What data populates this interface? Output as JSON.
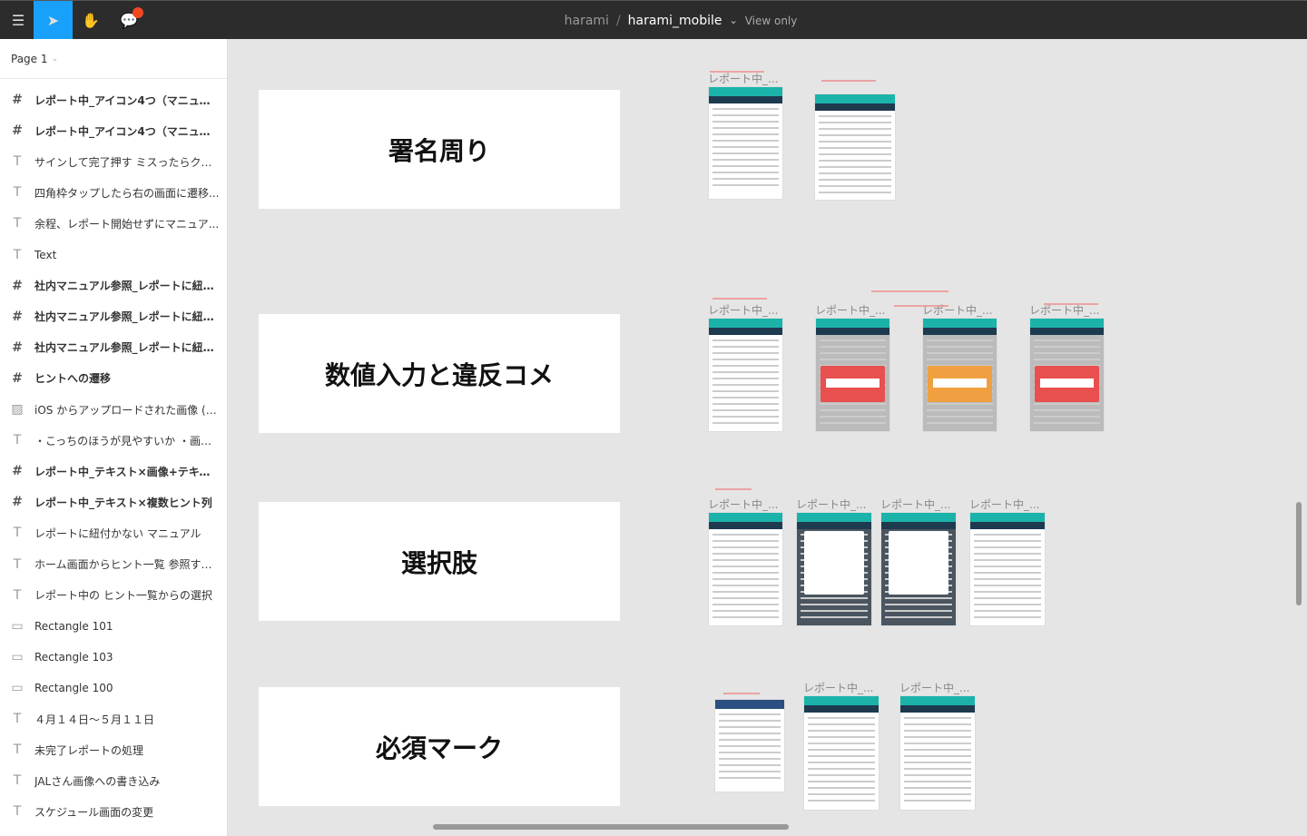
{
  "topbar": {
    "project": "harami",
    "separator": "/",
    "file": "harami_mobile",
    "chevron": "⌄",
    "mode": "View only"
  },
  "sidebar": {
    "page": "Page 1",
    "layers": [
      {
        "type": "frame",
        "label": "レポート中_アイコン4つ（マニュア..."
      },
      {
        "type": "frame",
        "label": "レポート中_アイコン4つ（マニュア..."
      },
      {
        "type": "text",
        "label": "サインして完了押す ミスったらクリ..."
      },
      {
        "type": "text",
        "label": "四角枠タップしたら右の画面に遷移..."
      },
      {
        "type": "text",
        "label": "余程、レポート開始せずにマニュア..."
      },
      {
        "type": "text",
        "label": "Text"
      },
      {
        "type": "frame",
        "label": "社内マニュアル参照_レポートに紐付..."
      },
      {
        "type": "frame",
        "label": "社内マニュアル参照_レポートに紐付..."
      },
      {
        "type": "frame",
        "label": "社内マニュアル参照_レポートに紐付..."
      },
      {
        "type": "frame",
        "label": "ヒントへの遷移"
      },
      {
        "type": "image",
        "label": "iOS からアップロードされた画像 (1..."
      },
      {
        "type": "text",
        "label": "・こっちのほうが見やすいか ・画像..."
      },
      {
        "type": "frame",
        "label": "レポート中_テキスト×画像+テキス..."
      },
      {
        "type": "frame",
        "label": "レポート中_テキスト×複数ヒント列"
      },
      {
        "type": "text",
        "label": "レポートに紐付かない マニュアル"
      },
      {
        "type": "text",
        "label": "ホーム画面からヒント一覧 参照する..."
      },
      {
        "type": "text",
        "label": "レポート中の ヒント一覧からの選択"
      },
      {
        "type": "rect",
        "label": "Rectangle 101"
      },
      {
        "type": "rect",
        "label": "Rectangle 103"
      },
      {
        "type": "rect",
        "label": "Rectangle 100"
      },
      {
        "type": "text",
        "label": "４月１４日〜５月１１日"
      },
      {
        "type": "text",
        "label": "未完了レポートの処理"
      },
      {
        "type": "text",
        "label": "JALさん画像への書き込み"
      },
      {
        "type": "text",
        "label": "スケジュール画面の変更"
      }
    ]
  },
  "canvas": {
    "sections": [
      "署名周り",
      "数値入力と違反コメ",
      "選択肢",
      "必須マーク"
    ],
    "frame_label": "レポート中_...",
    "overlay_colors": {
      "ng": "#e8504f",
      "warn": "#f0a040"
    }
  }
}
